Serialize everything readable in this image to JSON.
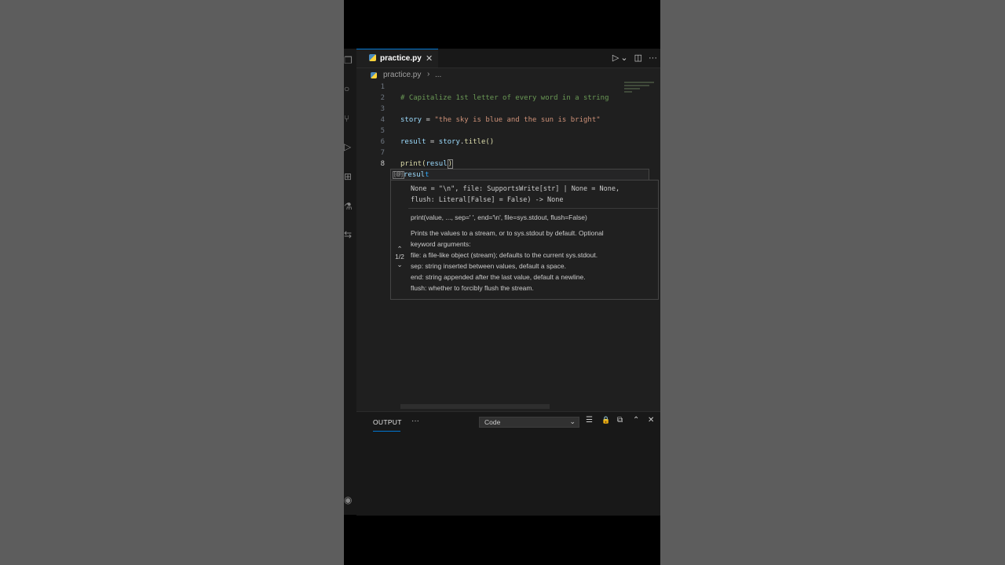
{
  "tab": {
    "filename": "practice.py",
    "close": "✕"
  },
  "tab_actions": {
    "run": "▷",
    "run_menu": "⌄",
    "split": "◫",
    "more": "···"
  },
  "breadcrumbs": {
    "file": "practice.py",
    "separator": "›",
    "more": "..."
  },
  "code_lines": [
    {
      "num": "1",
      "text": ""
    },
    {
      "num": "2",
      "comment": "# Capitalize 1st letter of every word in a string"
    },
    {
      "num": "3",
      "text": ""
    },
    {
      "num": "4",
      "var": "story",
      "op": " = ",
      "str": "\"the sky is blue and the sun is bright\""
    },
    {
      "num": "5",
      "text": ""
    },
    {
      "num": "6",
      "var": "result",
      "op": " = ",
      "var2": "story",
      "dot": ".",
      "fn": "title",
      "paren": "()"
    },
    {
      "num": "7",
      "text": ""
    },
    {
      "num": "8",
      "fn": "print",
      "paren": "(",
      "var": "resul",
      "close": ")"
    }
  ],
  "suggest": {
    "symbol": "[@]",
    "match": "resul",
    "rest": "t"
  },
  "hover": {
    "signature_line1": "None = \"\\n\", file: SupportsWrite[str] | None = None,",
    "signature_line2": "flush: Literal[False] = False) -> None",
    "signature_doc": "print(value, ..., sep=' ', end='\\n', file=sys.stdout, flush=False)",
    "doc_lines": [
      "Prints the values to a stream, or to sys.stdout by default. Optional",
      "keyword arguments:",
      "file: a file-like object (stream); defaults to the current sys.stdout.",
      "sep: string inserted between values, default a space.",
      "end: string appended after the last value, default a newline.",
      "flush: whether to forcibly flush the stream."
    ],
    "pager": "1/2",
    "pager_up": "⌃",
    "pager_down": "⌄"
  },
  "panel": {
    "tab_label": "OUTPUT",
    "more": "···",
    "select_value": "Code",
    "select_chevron": "⌄",
    "icons": {
      "list": "☰",
      "lock": "🔒",
      "copy": "⧉",
      "maximize": "⌃",
      "close": "✕"
    }
  },
  "activity_icons": [
    "files-icon",
    "search-icon",
    "source-control-icon",
    "run-debug-icon",
    "extensions-icon",
    "testing-icon",
    "remote-icon",
    "account-icon"
  ]
}
